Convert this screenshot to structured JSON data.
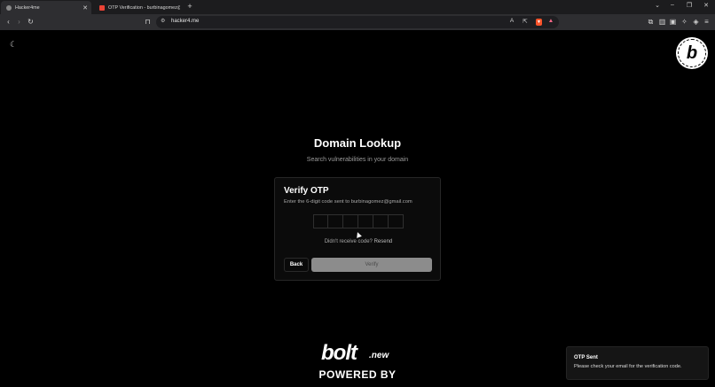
{
  "browser": {
    "tabs": [
      {
        "label": "Hacker4me",
        "active": true
      },
      {
        "label": "OTP Verification - burbinagomez@g...",
        "active": false
      }
    ],
    "new_tab": "+",
    "url": "hacker4.me"
  },
  "header": {
    "title": "Domain Lookup",
    "subtitle": "Search vulnerabilities in your domain"
  },
  "otp_card": {
    "title": "Verify OTP",
    "description": "Enter the 6-digit code sent to burbinagomez@gmail.com",
    "digits": [
      "",
      "",
      "",
      "",
      "",
      ""
    ],
    "resend_prompt": "Didn't receive code?",
    "resend_link": "Resend",
    "back_label": "Back",
    "verify_label": "Verify"
  },
  "footer": {
    "logo_word": "bolt",
    "logo_tld": ".new",
    "powered_by": "POWERED BY"
  },
  "toast": {
    "title": "OTP Sent",
    "message": "Please check your email for the verification code."
  },
  "badge": {
    "letter": "b"
  },
  "colors": {
    "background": "#000000",
    "card": "#0b0b0b",
    "verify_button": "#8c8c8c",
    "brave_accent": "#fb542b"
  },
  "icons": [
    "moon-icon",
    "back-icon",
    "forward-icon",
    "reload-icon",
    "bookmark-icon",
    "site-settings-icon",
    "translate-icon",
    "share-icon",
    "brave-shields-icon",
    "rewards-icon",
    "extensions-icon",
    "sidebar-icon",
    "wallet-icon",
    "leo-icon",
    "vpn-icon",
    "menu-icon"
  ]
}
